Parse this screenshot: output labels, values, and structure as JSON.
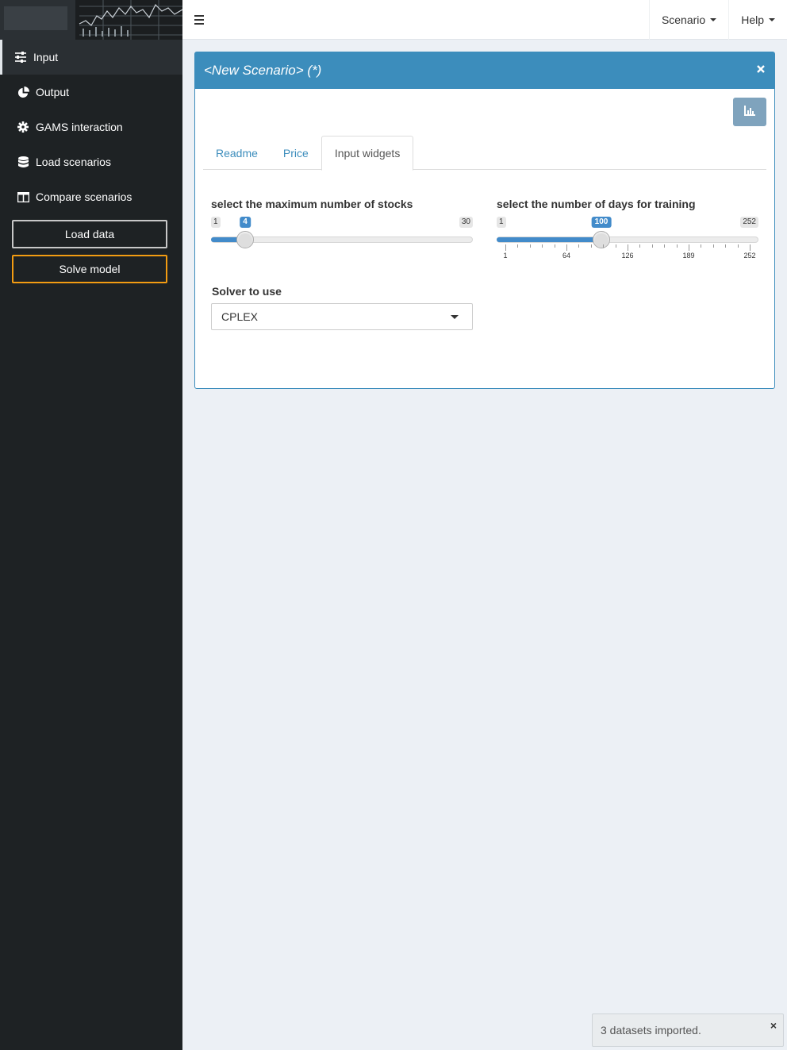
{
  "sidebar": {
    "items": [
      {
        "label": "Input",
        "icon": "sliders-icon",
        "active": true
      },
      {
        "label": "Output",
        "icon": "pie-chart-icon"
      },
      {
        "label": "GAMS interaction",
        "icon": "gear-icon"
      },
      {
        "label": "Load scenarios",
        "icon": "database-icon"
      },
      {
        "label": "Compare scenarios",
        "icon": "columns-icon"
      }
    ],
    "load_button": "Load data",
    "solve_button": "Solve model"
  },
  "topbar": {
    "scenario_menu": "Scenario",
    "help_menu": "Help"
  },
  "box": {
    "title": "<New Scenario> (*)",
    "tabs": [
      {
        "label": "Readme"
      },
      {
        "label": "Price"
      },
      {
        "label": "Input widgets",
        "active": true
      }
    ],
    "stocks_slider": {
      "label": "select the maximum number of stocks",
      "min": "1",
      "max": "30",
      "value": "4"
    },
    "days_slider": {
      "label": "select the number of days for training",
      "min": "1",
      "max": "252",
      "value": "100",
      "tick_labels": [
        "1",
        "64",
        "126",
        "189",
        "252"
      ]
    },
    "solver": {
      "label": "Solver to use",
      "value": "CPLEX"
    }
  },
  "notification": {
    "text": "3 datasets imported."
  },
  "colors": {
    "primary": "#3c8dbc",
    "slider_fill": "#428bca",
    "solve_border": "#f39c12",
    "sidebar_bg": "#1e2224"
  }
}
